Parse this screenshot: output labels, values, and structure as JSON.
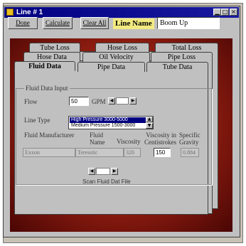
{
  "window": {
    "title": "Line # 1"
  },
  "titlebar_buttons": [
    "minimize",
    "maximize",
    "close"
  ],
  "toolbar": {
    "done_label": "Done",
    "calculate_label": "Calculate",
    "clear_all_label": "Clear All",
    "line_name_label": "Line Name",
    "line_name_value": "Boom Up"
  },
  "tabs": {
    "row1": [
      "Tube Loss",
      "Hose Loss",
      "Total Loss"
    ],
    "row2": [
      "Hose Data",
      "Oil Velocity",
      "Pipe Loss"
    ],
    "row3": [
      "Fluid Data",
      "Pipe Data",
      "Tube Data"
    ],
    "active": "Fluid Data"
  },
  "fluid": {
    "group_title": "Fluid Data Input",
    "flow_label": "Flow",
    "flow_value": "50",
    "flow_unit": "GPM",
    "line_type_label": "Line Type",
    "line_type_options": [
      "High Pressure 3000-5000",
      "Medium Pressure 1500-3000"
    ],
    "line_type_selected": "High Pressure 3000-5000",
    "col_manufacturer": "Fluid Manufacturer",
    "col_name": "Fluid Name",
    "col_viscosity": "Viscosity",
    "col_visc_cs": "Viscosity in Centistrokes",
    "col_gravity": "Specific Gravity",
    "manufacturer_value": "Exxon",
    "name_value": "Teresstic",
    "viscosity_value": "320",
    "visc_cs_value": "150",
    "gravity_value": "0.884",
    "scan_label": "Scan Fluid Dat File"
  }
}
